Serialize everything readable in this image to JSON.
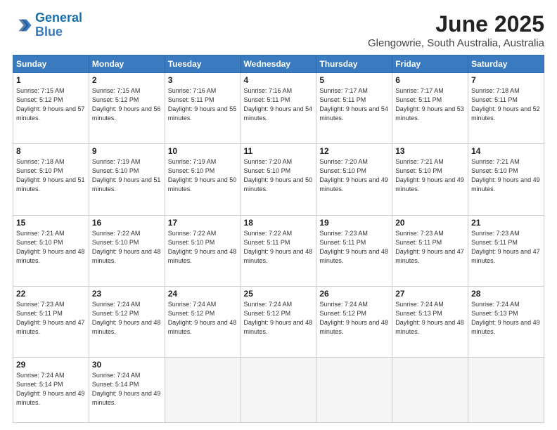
{
  "header": {
    "logo_line1": "General",
    "logo_line2": "Blue",
    "month_year": "June 2025",
    "location": "Glengowrie, South Australia, Australia"
  },
  "weekdays": [
    "Sunday",
    "Monday",
    "Tuesday",
    "Wednesday",
    "Thursday",
    "Friday",
    "Saturday"
  ],
  "weeks": [
    [
      {
        "day": 1,
        "sunrise": "7:15 AM",
        "sunset": "5:12 PM",
        "daylight": "9 hours and 57 minutes."
      },
      {
        "day": 2,
        "sunrise": "7:15 AM",
        "sunset": "5:12 PM",
        "daylight": "9 hours and 56 minutes."
      },
      {
        "day": 3,
        "sunrise": "7:16 AM",
        "sunset": "5:11 PM",
        "daylight": "9 hours and 55 minutes."
      },
      {
        "day": 4,
        "sunrise": "7:16 AM",
        "sunset": "5:11 PM",
        "daylight": "9 hours and 54 minutes."
      },
      {
        "day": 5,
        "sunrise": "7:17 AM",
        "sunset": "5:11 PM",
        "daylight": "9 hours and 54 minutes."
      },
      {
        "day": 6,
        "sunrise": "7:17 AM",
        "sunset": "5:11 PM",
        "daylight": "9 hours and 53 minutes."
      },
      {
        "day": 7,
        "sunrise": "7:18 AM",
        "sunset": "5:11 PM",
        "daylight": "9 hours and 52 minutes."
      }
    ],
    [
      {
        "day": 8,
        "sunrise": "7:18 AM",
        "sunset": "5:10 PM",
        "daylight": "9 hours and 51 minutes."
      },
      {
        "day": 9,
        "sunrise": "7:19 AM",
        "sunset": "5:10 PM",
        "daylight": "9 hours and 51 minutes."
      },
      {
        "day": 10,
        "sunrise": "7:19 AM",
        "sunset": "5:10 PM",
        "daylight": "9 hours and 50 minutes."
      },
      {
        "day": 11,
        "sunrise": "7:20 AM",
        "sunset": "5:10 PM",
        "daylight": "9 hours and 50 minutes."
      },
      {
        "day": 12,
        "sunrise": "7:20 AM",
        "sunset": "5:10 PM",
        "daylight": "9 hours and 49 minutes."
      },
      {
        "day": 13,
        "sunrise": "7:21 AM",
        "sunset": "5:10 PM",
        "daylight": "9 hours and 49 minutes."
      },
      {
        "day": 14,
        "sunrise": "7:21 AM",
        "sunset": "5:10 PM",
        "daylight": "9 hours and 49 minutes."
      }
    ],
    [
      {
        "day": 15,
        "sunrise": "7:21 AM",
        "sunset": "5:10 PM",
        "daylight": "9 hours and 48 minutes."
      },
      {
        "day": 16,
        "sunrise": "7:22 AM",
        "sunset": "5:10 PM",
        "daylight": "9 hours and 48 minutes."
      },
      {
        "day": 17,
        "sunrise": "7:22 AM",
        "sunset": "5:10 PM",
        "daylight": "9 hours and 48 minutes."
      },
      {
        "day": 18,
        "sunrise": "7:22 AM",
        "sunset": "5:11 PM",
        "daylight": "9 hours and 48 minutes."
      },
      {
        "day": 19,
        "sunrise": "7:23 AM",
        "sunset": "5:11 PM",
        "daylight": "9 hours and 48 minutes."
      },
      {
        "day": 20,
        "sunrise": "7:23 AM",
        "sunset": "5:11 PM",
        "daylight": "9 hours and 47 minutes."
      },
      {
        "day": 21,
        "sunrise": "7:23 AM",
        "sunset": "5:11 PM",
        "daylight": "9 hours and 47 minutes."
      }
    ],
    [
      {
        "day": 22,
        "sunrise": "7:23 AM",
        "sunset": "5:11 PM",
        "daylight": "9 hours and 47 minutes."
      },
      {
        "day": 23,
        "sunrise": "7:24 AM",
        "sunset": "5:12 PM",
        "daylight": "9 hours and 48 minutes."
      },
      {
        "day": 24,
        "sunrise": "7:24 AM",
        "sunset": "5:12 PM",
        "daylight": "9 hours and 48 minutes."
      },
      {
        "day": 25,
        "sunrise": "7:24 AM",
        "sunset": "5:12 PM",
        "daylight": "9 hours and 48 minutes."
      },
      {
        "day": 26,
        "sunrise": "7:24 AM",
        "sunset": "5:12 PM",
        "daylight": "9 hours and 48 minutes."
      },
      {
        "day": 27,
        "sunrise": "7:24 AM",
        "sunset": "5:13 PM",
        "daylight": "9 hours and 48 minutes."
      },
      {
        "day": 28,
        "sunrise": "7:24 AM",
        "sunset": "5:13 PM",
        "daylight": "9 hours and 49 minutes."
      }
    ],
    [
      {
        "day": 29,
        "sunrise": "7:24 AM",
        "sunset": "5:14 PM",
        "daylight": "9 hours and 49 minutes."
      },
      {
        "day": 30,
        "sunrise": "7:24 AM",
        "sunset": "5:14 PM",
        "daylight": "9 hours and 49 minutes."
      },
      null,
      null,
      null,
      null,
      null
    ]
  ]
}
